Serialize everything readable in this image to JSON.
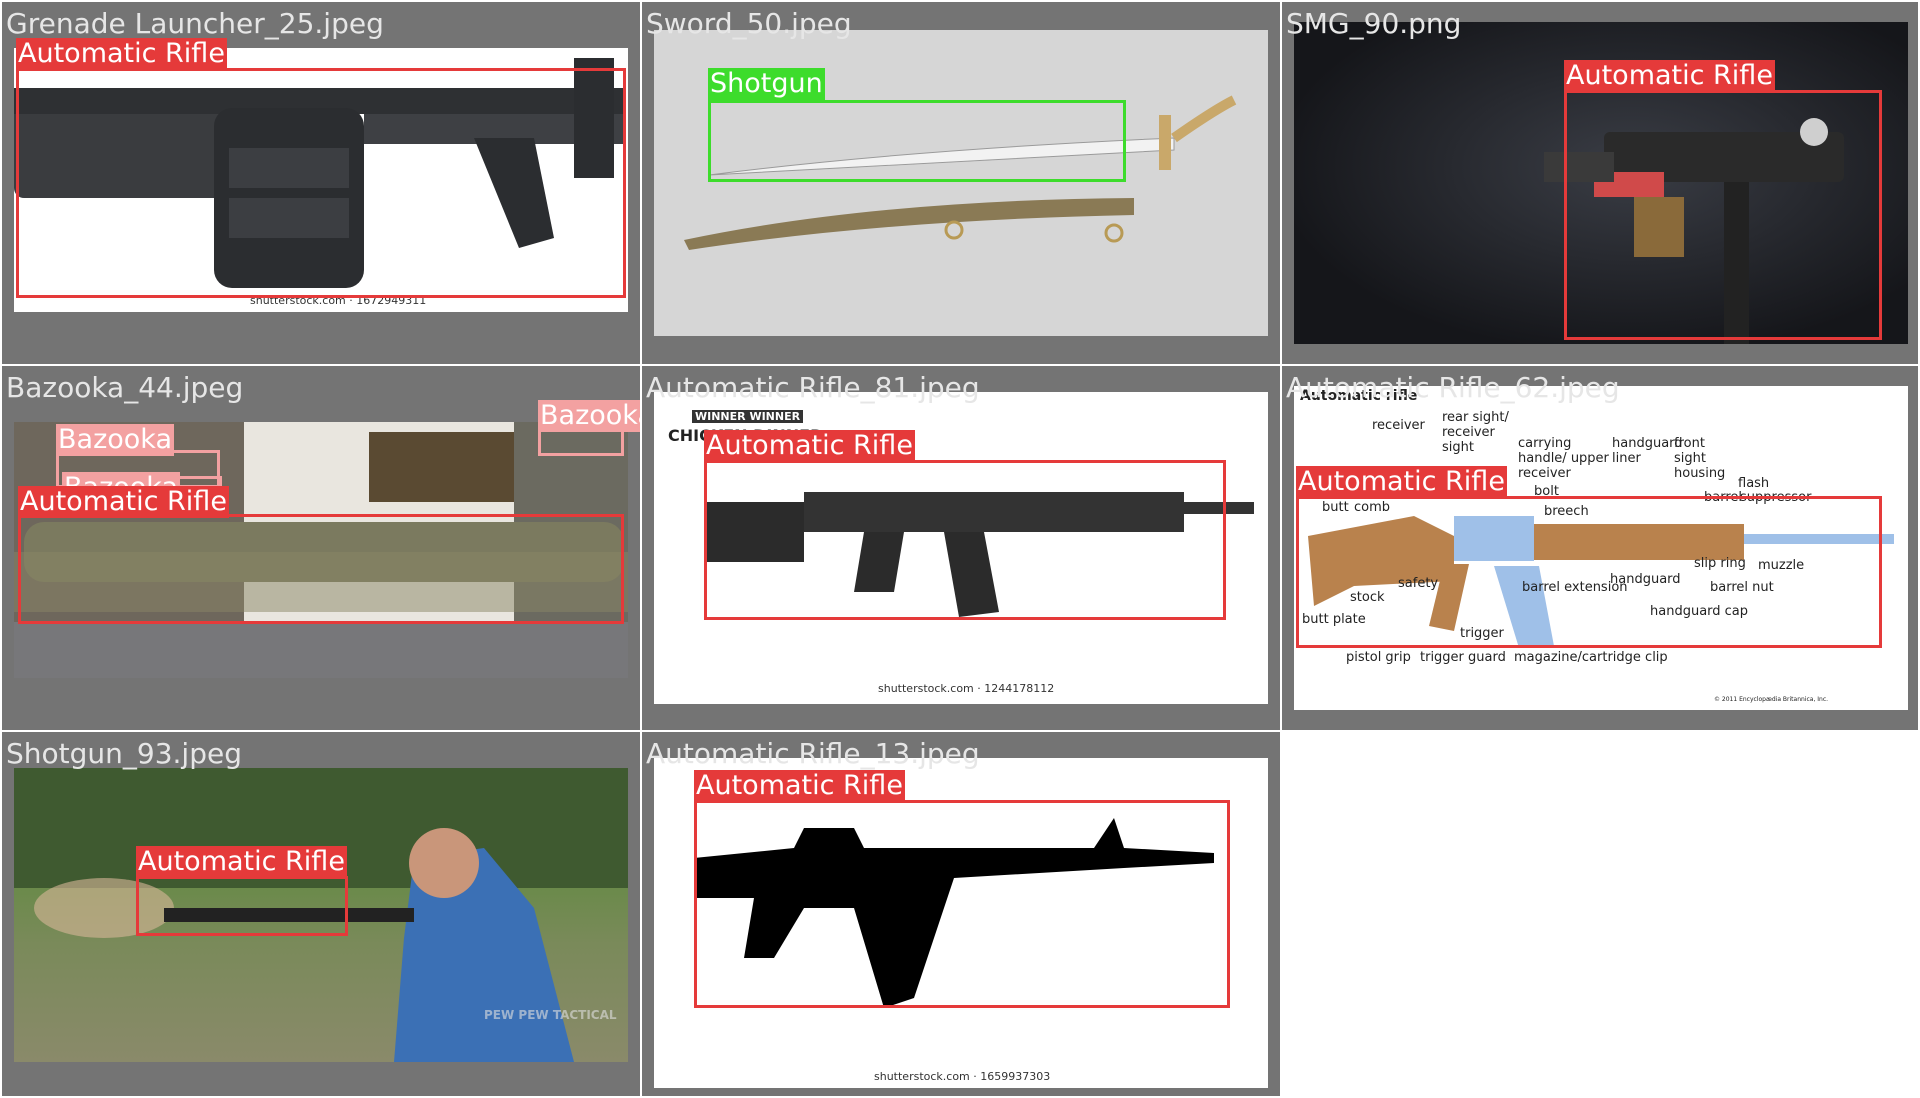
{
  "tiles": [
    {
      "filename": "Grenade Launcher_25.jpeg",
      "credit": "shutterstock.com · 1672949311",
      "detections": [
        {
          "label": "Automatic Rifle",
          "color": "#e53a3a"
        }
      ]
    },
    {
      "filename": "Sword_50.jpeg",
      "detections": [
        {
          "label": "Shotgun",
          "color": "#3ddc2c"
        }
      ]
    },
    {
      "filename": "SMG_90.png",
      "detections": [
        {
          "label": "Automatic Rifle",
          "color": "#e53a3a"
        }
      ]
    },
    {
      "filename": "Bazooka_44.jpeg",
      "detections": [
        {
          "label": "Bazooka",
          "color": "#f3a1a1"
        },
        {
          "label": "Bazooka",
          "color": "#f3a1a1"
        },
        {
          "label": "Bazooka",
          "color": "#f3a1a1"
        },
        {
          "label": "Automatic Rifle",
          "color": "#e53a3a"
        }
      ]
    },
    {
      "filename": "Automatic Rifle_81.jpeg",
      "badge": "WINNER WINNER",
      "watermark": "CHICKEN DINNER",
      "credit": "shutterstock.com · 1244178112",
      "detections": [
        {
          "label": "Automatic Rifle",
          "color": "#e53a3a"
        }
      ]
    },
    {
      "filename": "Automatic Rifle_62.jpeg",
      "diagram_title": "Automatic rifle",
      "parts": [
        "receiver",
        "rear sight/ receiver sight",
        "carrying handle/ upper receiver",
        "handguard liner",
        "front sight housing",
        "flash",
        "barrel",
        "suppressor",
        "bolt",
        "breech",
        "butt",
        "comb",
        "slip ring",
        "muzzle",
        "barrel nut",
        "handguard",
        "safety",
        "stock",
        "barrel extension",
        "handguard cap",
        "butt plate",
        "trigger",
        "pistol grip",
        "trigger guard",
        "magazine/cartridge clip"
      ],
      "copyright": "© 2011 Encyclopædia Britannica, Inc.",
      "detections": [
        {
          "label": "Automatic Rifle",
          "color": "#e53a3a"
        }
      ]
    },
    {
      "filename": "Shotgun_93.jpeg",
      "watermark": "PEW PEW TACTICAL",
      "detections": [
        {
          "label": "Automatic Rifle",
          "color": "#e53a3a"
        }
      ]
    },
    {
      "filename": "Automatic Rifle_13.jpeg",
      "credit": "shutterstock.com · 1659937303",
      "detections": [
        {
          "label": "Automatic Rifle",
          "color": "#e53a3a"
        }
      ]
    }
  ]
}
